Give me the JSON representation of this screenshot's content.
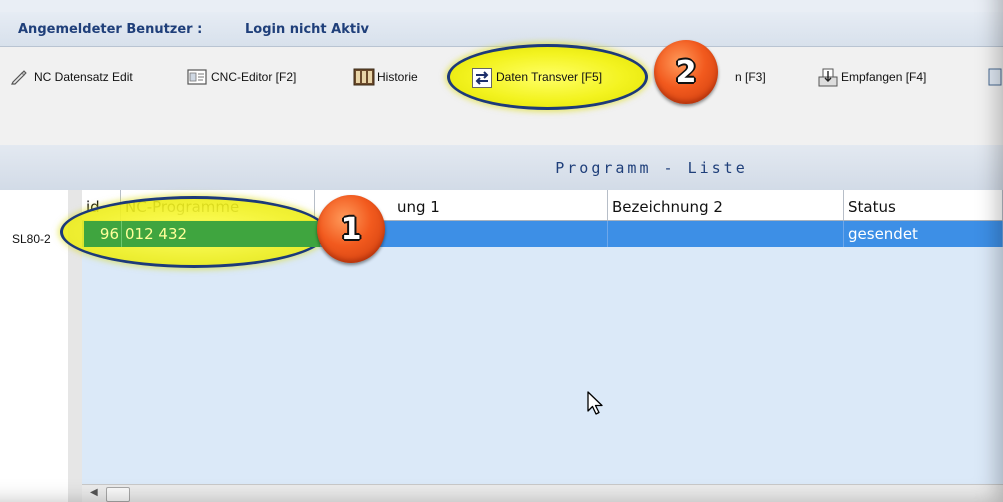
{
  "login": {
    "label": "Angemeldeter Benutzer :",
    "value": "Login nicht Aktiv"
  },
  "toolbar": {
    "buttons": [
      {
        "label": "NC Datensatz Edit",
        "icon": "edit-icon"
      },
      {
        "label": "CNC-Editor [F2]",
        "icon": "editor-icon"
      },
      {
        "label": "Historie",
        "icon": "history-icon"
      },
      {
        "label": "Daten Transver [F5]",
        "icon": "transfer-arrows-icon"
      },
      {
        "label": "n [F3]",
        "icon": "send-icon"
      },
      {
        "label": "Empfangen [F4]",
        "icon": "receive-icon"
      }
    ]
  },
  "annotations": {
    "badge1": "1",
    "badge2": "2"
  },
  "list": {
    "title": "Programm - Liste"
  },
  "tree": {
    "item": "SL80-2"
  },
  "table": {
    "columns": [
      "id",
      "NC-Programme",
      "ung 1",
      "Bezeichnung 2",
      "Status"
    ],
    "rows": [
      {
        "id": "96",
        "program": "012 432",
        "bez1": "",
        "bez2": "",
        "status": "gesendet"
      }
    ]
  },
  "colors": {
    "accent": "#1f3f7a",
    "highlight": "#f3f320",
    "badge": "#f25a1e",
    "selectedRow": "#3d8fe6"
  }
}
